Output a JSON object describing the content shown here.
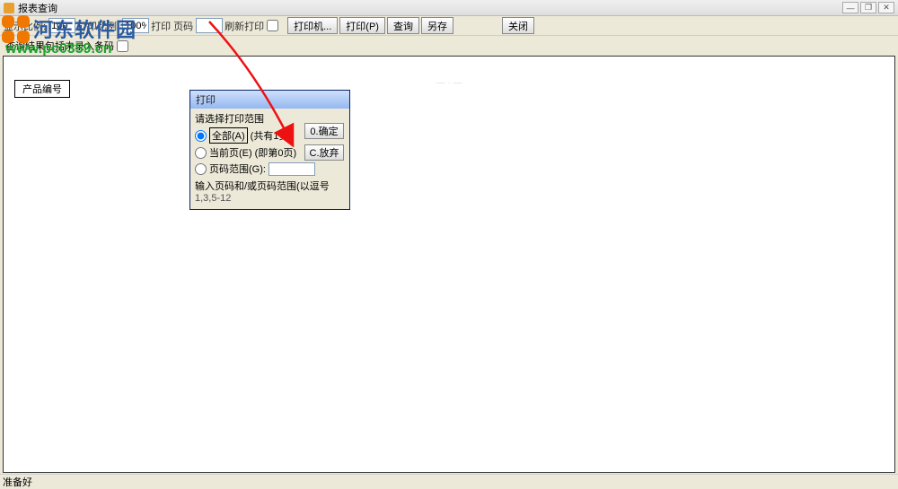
{
  "window": {
    "title": "报表查询"
  },
  "toolbar": {
    "zoom_ratio_label": "显示比例:",
    "zoom_value": "100",
    "print_ratio_label": "打印比例:",
    "print_zoom": "100%",
    "print_label": "打印",
    "page_label": "页码",
    "refresh_print": "刷新打印",
    "btn_printer": "打印机...",
    "btn_print": "打印(P)",
    "btn_query": "查询",
    "btn_saveas": "另存",
    "btn_close": "关闭"
  },
  "checkbox_row": {
    "label": "查询结果包括未录入条码"
  },
  "content": {
    "column_header": "产品编号"
  },
  "dialog": {
    "title": "打印",
    "prompt": "请选择打印范围",
    "opt_all": "全部(A)",
    "all_suffix": "(共有1页)",
    "opt_current": "当前页(E)",
    "current_suffix": "(即第0页)",
    "opt_range": "页码范围(G):",
    "hint1": "输入页码和/或页码范围(以逗号",
    "hint2": "1,3,5-12",
    "btn_ok": "0.确定",
    "btn_cancel": "C.放弃"
  },
  "statusbar": {
    "text": "准备好"
  },
  "watermark": {
    "brand": "河东软件园",
    "url": "www.pc0359.cn"
  }
}
